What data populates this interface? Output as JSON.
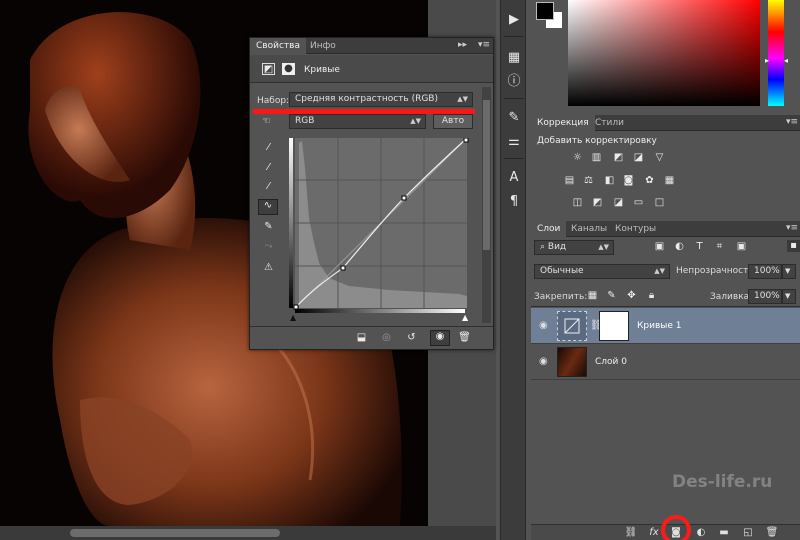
{
  "properties": {
    "tabs": [
      "Свойства",
      "Инфо"
    ],
    "adjustment_title": "Кривые",
    "preset_label": "Набор:",
    "preset_value": "Средняя контрастность (RGB)",
    "channel_value": "RGB",
    "auto_button": "Авто"
  },
  "correction": {
    "tabs": [
      "Коррекция",
      "Стили"
    ],
    "heading": "Добавить корректировку"
  },
  "layers": {
    "tabs": [
      "Слои",
      "Каналы",
      "Контуры"
    ],
    "filter_value": "Вид",
    "blend_mode": "Обычные",
    "opacity_label": "Непрозрачность:",
    "opacity_value": "100%",
    "lock_label": "Закрепить:",
    "fill_label": "Заливка:",
    "fill_value": "100%",
    "items": [
      {
        "name": "Кривые 1",
        "selected": true
      },
      {
        "name": "Слой 0",
        "selected": false
      }
    ]
  },
  "watermark": "Des-life.ru",
  "colors": {
    "highlight": "#ff1515",
    "selected_layer": "#6f7f96",
    "foreground": "#000000",
    "background": "#ffffff"
  }
}
